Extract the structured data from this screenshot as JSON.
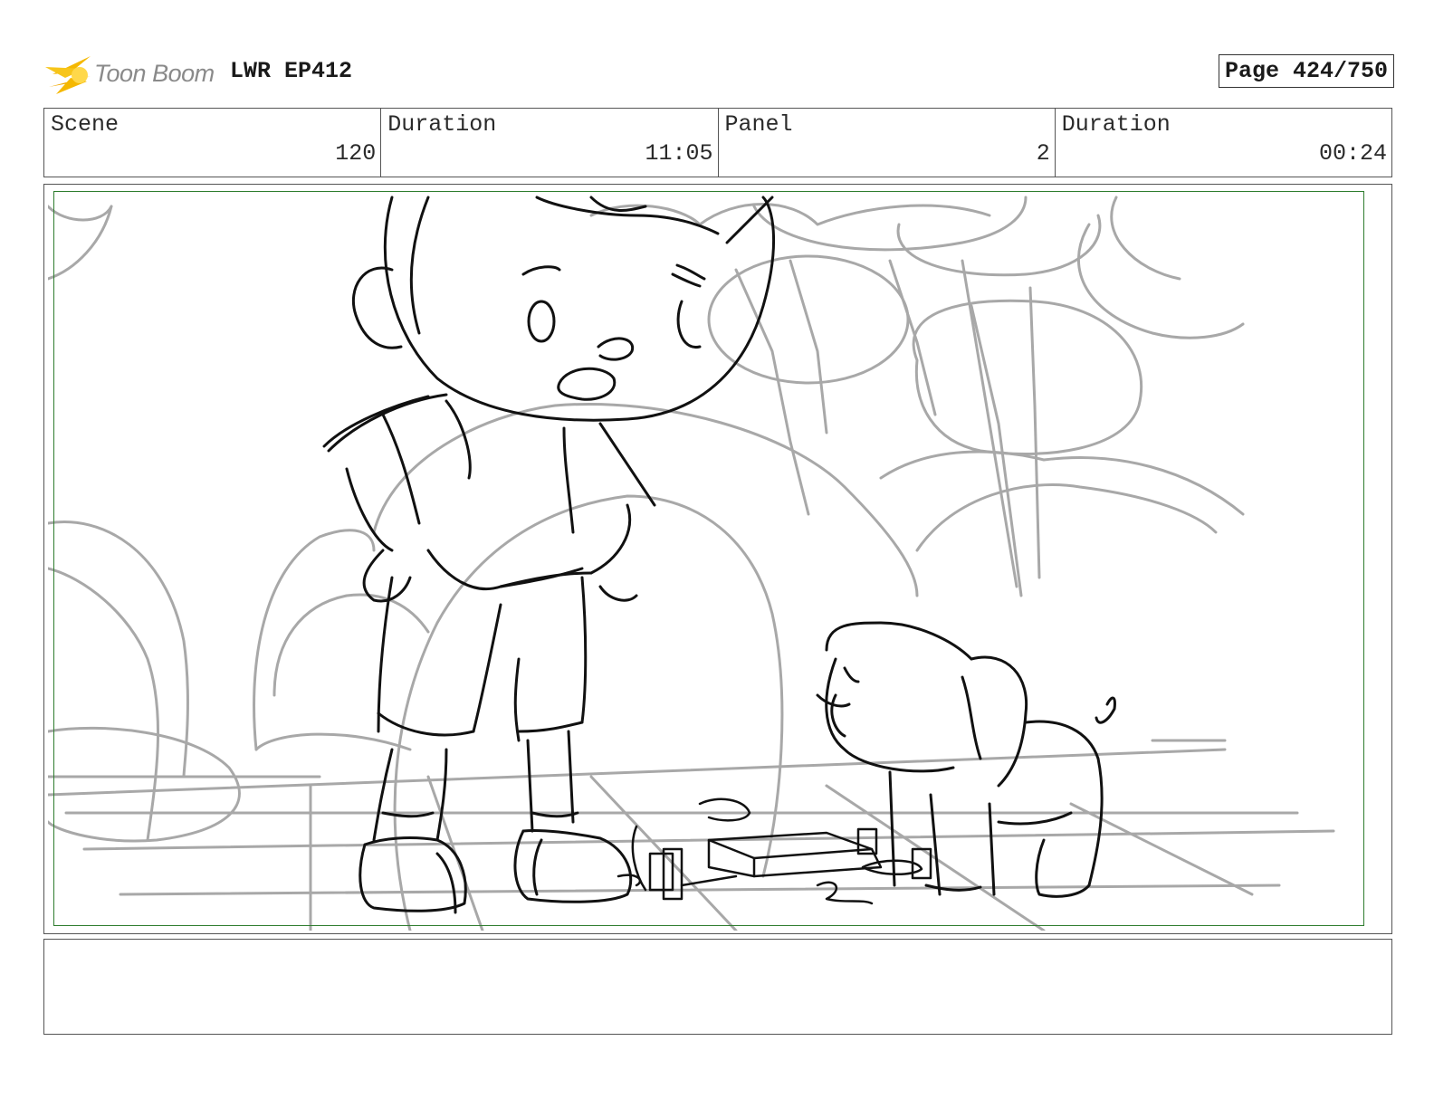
{
  "header": {
    "logo_text": "Toon Boom",
    "project": "LWR EP412",
    "page": "Page 424/750"
  },
  "info": {
    "scene_label": "Scene",
    "scene_value": "120",
    "scene_duration_label": "Duration",
    "scene_duration_value": "11:05",
    "panel_label": "Panel",
    "panel_value": "2",
    "panel_duration_label": "Duration",
    "panel_duration_value": "00:24"
  },
  "colors": {
    "safe_frame": "#2e7d2e",
    "logo_accent": "#f5b800",
    "sketch_ink": "#111111",
    "sketch_bg": "#a8a8a8"
  },
  "icons": [
    "toon-boom-logo-icon"
  ],
  "notes": ""
}
